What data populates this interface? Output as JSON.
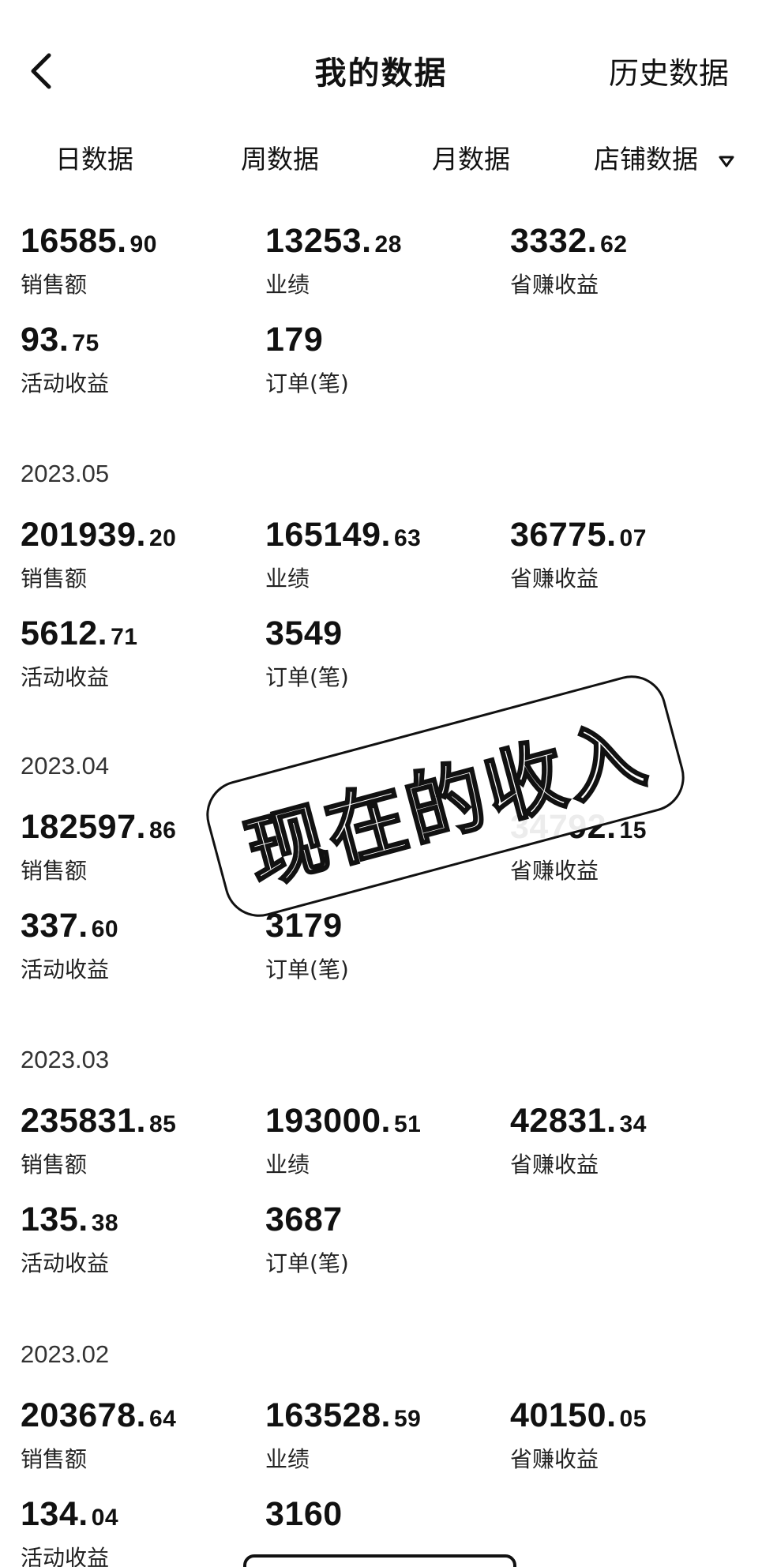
{
  "header": {
    "title": "我的数据",
    "history": "历史数据"
  },
  "tabs": [
    "日数据",
    "周数据",
    "月数据",
    "店铺数据"
  ],
  "today": {
    "sales": {
      "int": "16585.",
      "dec": "90",
      "label": "销售额"
    },
    "performance": {
      "int": "13253.",
      "dec": "28",
      "label": "业绩"
    },
    "savings": {
      "int": "3332.",
      "dec": "62",
      "label": "省赚收益"
    },
    "activity": {
      "int": "93.",
      "dec": "75",
      "label": "活动收益"
    },
    "orders": {
      "int": "179",
      "dec": "",
      "label": "订单(笔)"
    }
  },
  "months": [
    {
      "month": "2023.05",
      "sales": {
        "int": "201939.",
        "dec": "20",
        "label": "销售额"
      },
      "performance": {
        "int": "165149.",
        "dec": "63",
        "label": "业绩"
      },
      "savings": {
        "int": "36775.",
        "dec": "07",
        "label": "省赚收益"
      },
      "activity": {
        "int": "5612.",
        "dec": "71",
        "label": "活动收益"
      },
      "orders": {
        "int": "3549",
        "dec": "",
        "label": "订单(笔)"
      }
    },
    {
      "month": "2023.04",
      "sales": {
        "int": "182597.",
        "dec": "86",
        "label": "销售额"
      },
      "performance": {
        "int": "",
        "dec": "",
        "label": ""
      },
      "savings": {
        "int": "34792.",
        "dec": "15",
        "label": "省赚收益"
      },
      "activity": {
        "int": "337.",
        "dec": "60",
        "label": "活动收益"
      },
      "orders": {
        "int": "3179",
        "dec": "",
        "label": "订单(笔)"
      }
    },
    {
      "month": "2023.03",
      "sales": {
        "int": "235831.",
        "dec": "85",
        "label": "销售额"
      },
      "performance": {
        "int": "193000.",
        "dec": "51",
        "label": "业绩"
      },
      "savings": {
        "int": "42831.",
        "dec": "34",
        "label": "省赚收益"
      },
      "activity": {
        "int": "135.",
        "dec": "38",
        "label": "活动收益"
      },
      "orders": {
        "int": "3687",
        "dec": "",
        "label": "订单(笔)"
      }
    },
    {
      "month": "2023.02",
      "sales": {
        "int": "203678.",
        "dec": "64",
        "label": "销售额"
      },
      "performance": {
        "int": "163528.",
        "dec": "59",
        "label": "业绩"
      },
      "savings": {
        "int": "40150.",
        "dec": "05",
        "label": "省赚收益"
      },
      "activity": {
        "int": "134.",
        "dec": "04",
        "label": "活动收益"
      },
      "orders": {
        "int": "3160",
        "dec": "",
        "label": ""
      }
    }
  ],
  "stamp": "现在的收入",
  "icons": {
    "back": "chevron-left-icon",
    "dropdown": "caret-down-icon"
  }
}
